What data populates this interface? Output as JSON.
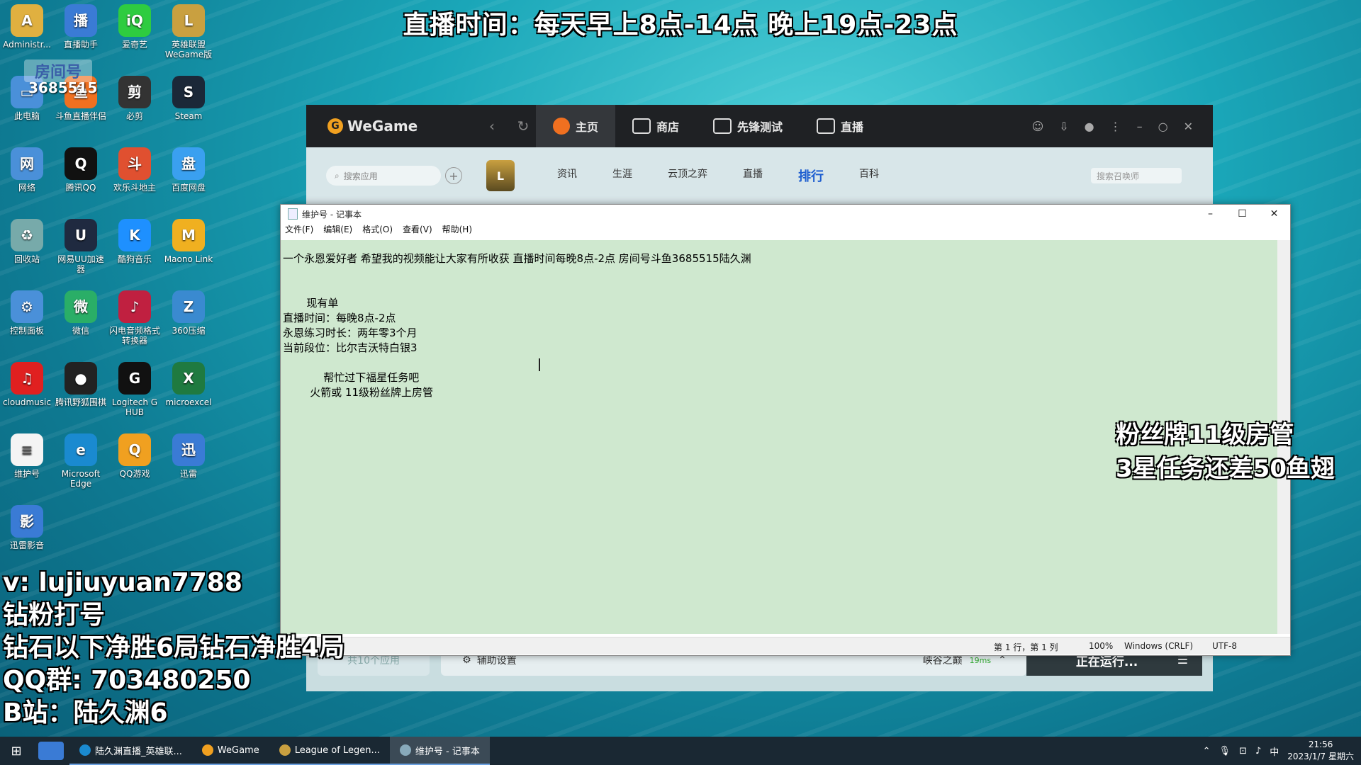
{
  "overlay": {
    "top": "直播时间：每天早上8点-14点 晚上19点-23点",
    "room_label": "房间号",
    "room_num": "3685515",
    "left_lines": [
      "v: lujiuyuan7788",
      "钻粉打号",
      "钻石以下净胜6局钻石净胜4局",
      "QQ群: 703480250",
      "B站：陆久渊6"
    ],
    "right_lines": [
      "粉丝牌11级房管",
      "3星任务还差50鱼翅"
    ]
  },
  "desktop_icons": [
    {
      "label": "Administr...",
      "color": "#e0b040",
      "glyph": "A"
    },
    {
      "label": "直播助手",
      "color": "#3a7bd5",
      "glyph": "播"
    },
    {
      "label": "爱奇艺",
      "color": "#2ecc40",
      "glyph": "iQ"
    },
    {
      "label": "英雄联盟 WeGame版",
      "color": "#c9a040",
      "glyph": "L"
    },
    {
      "label": "此电脑",
      "color": "#4a90d9",
      "glyph": "▭"
    },
    {
      "label": "斗鱼直播伴侣",
      "color": "#f07020",
      "glyph": "鱼"
    },
    {
      "label": "必剪",
      "color": "#333",
      "glyph": "剪"
    },
    {
      "label": "Steam",
      "color": "#1b2838",
      "glyph": "S"
    },
    {
      "label": "网络",
      "color": "#4a90d9",
      "glyph": "网"
    },
    {
      "label": "腾讯QQ",
      "color": "#111",
      "glyph": "Q"
    },
    {
      "label": "欢乐斗地主",
      "color": "#e05030",
      "glyph": "斗"
    },
    {
      "label": "百度网盘",
      "color": "#3aa0f0",
      "glyph": "盘"
    },
    {
      "label": "回收站",
      "color": "#7aa",
      "glyph": "♻"
    },
    {
      "label": "网易UU加速器",
      "color": "#1f2a40",
      "glyph": "U"
    },
    {
      "label": "酷狗音乐",
      "color": "#1e90ff",
      "glyph": "K"
    },
    {
      "label": "Maono Link",
      "color": "#f0b020",
      "glyph": "M"
    },
    {
      "label": "控制面板",
      "color": "#4a90d9",
      "glyph": "⚙"
    },
    {
      "label": "微信",
      "color": "#2aae67",
      "glyph": "微"
    },
    {
      "label": "闪电音频格式转换器",
      "color": "#c02040",
      "glyph": "♪"
    },
    {
      "label": "360压缩",
      "color": "#3a8ad0",
      "glyph": "Z"
    },
    {
      "label": "cloudmusic",
      "color": "#e02020",
      "glyph": "♫"
    },
    {
      "label": "腾讯野狐围棋",
      "color": "#222",
      "glyph": "●"
    },
    {
      "label": "Logitech G HUB",
      "color": "#111",
      "glyph": "G"
    },
    {
      "label": "microexcel",
      "color": "#1f7a40",
      "glyph": "X"
    },
    {
      "label": "维护号",
      "color": "#f4f4f4",
      "glyph": "≡"
    },
    {
      "label": "Microsoft Edge",
      "color": "#1a8ad0",
      "glyph": "e"
    },
    {
      "label": "QQ游戏",
      "color": "#f0a020",
      "glyph": "Q"
    },
    {
      "label": "迅雷",
      "color": "#3a7bd5",
      "glyph": "迅"
    },
    {
      "label": "迅雷影音",
      "color": "#3a7bd5",
      "glyph": "影"
    }
  ],
  "wegame": {
    "logo": "WeGame",
    "tabs": [
      "主页",
      "商店",
      "先锋测试",
      "直播"
    ],
    "sub_menu": [
      "资讯",
      "生涯",
      "云顶之弈",
      "直播",
      "排行",
      "百科"
    ],
    "search_placeholder": "搜索应用",
    "search2_placeholder": "搜索召唤师",
    "app_count": "共10个应用",
    "assist": "辅助设置",
    "game_name": "峡谷之巅",
    "ping": "19ms",
    "running": "正在运行..."
  },
  "notepad": {
    "title": "维护号 - 记事本",
    "menu": [
      "文件(F)",
      "编辑(E)",
      "格式(O)",
      "查看(V)",
      "帮助(H)"
    ],
    "lines": [
      "一个永恩爱好者 希望我的视频能让大家有所收获 直播时间每晚8点-2点 房间号斗鱼3685515陆久渊",
      "",
      "",
      "       现有单",
      "直播时间：每晚8点-2点",
      "永恩练习时长：两年零3个月",
      "当前段位：比尔吉沃特白银3",
      "",
      "            帮忙过下福星任务吧",
      "        火箭或 11级粉丝牌上房管"
    ],
    "status": {
      "position": "第 1 行，第 1 列",
      "zoom": "100%",
      "eol": "Windows (CRLF)",
      "encoding": "UTF-8"
    }
  },
  "taskbar": {
    "items": [
      "陆久渊直播_英雄联...",
      "WeGame",
      "League of Legen...",
      "维护号 - 记事本"
    ],
    "ime": "中",
    "time": "21:56",
    "date": "2023/1/7 星期六"
  }
}
